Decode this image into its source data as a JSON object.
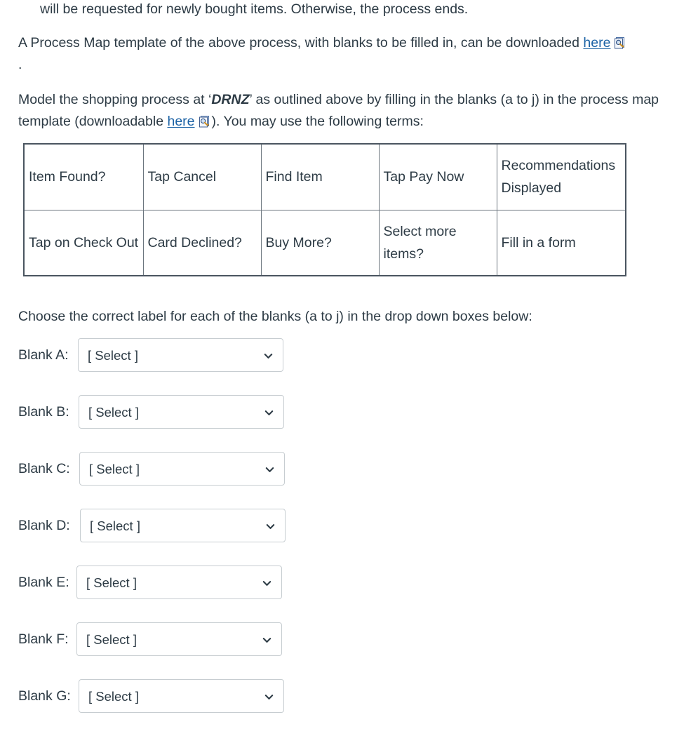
{
  "paragraphs": {
    "p1": "will be requested for newly bought items. Otherwise, the process ends.",
    "p2_before": "A Process Map template of the above process, with blanks to be filled in, can be downloaded ",
    "p2_link": "here",
    "p2_dot": ".",
    "p3_a": "Model the shopping process at ‘",
    "p3_emph": "DRNZ",
    "p3_b": "’ as outlined above by filling in the blanks (a to j) in the process map template (downloadable ",
    "p3_link": "here",
    "p3_c": "). You may use the following terms:",
    "p4": "Choose the correct label for each of the blanks (a to j) in the drop down boxes below:"
  },
  "terms_table": {
    "rows": [
      [
        "Item Found?",
        "Tap Cancel",
        "Find Item",
        "Tap Pay Now",
        "Recommendations Displayed"
      ],
      [
        "Tap on Check Out",
        "Card Declined?",
        "Buy More?",
        "Select more items?",
        "Fill in a form"
      ]
    ]
  },
  "blanks": [
    {
      "label": "Blank A:",
      "value": "[ Select ]",
      "left_label": 26,
      "left_select": 111
    },
    {
      "label": "Blank B:",
      "value": "[ Select ]",
      "left_label": 26,
      "left_select": 112
    },
    {
      "label": "Blank C:",
      "value": "[ Select ]",
      "left_label": 26,
      "left_select": 113
    },
    {
      "label": "Blank D:",
      "value": "[ Select ]",
      "left_label": 26,
      "left_select": 114
    },
    {
      "label": "Blank E:",
      "value": "[ Select ]",
      "left_label": 26,
      "left_select": 109
    },
    {
      "label": "Blank F:",
      "value": "[ Select ]",
      "left_label": 26,
      "left_select": 109
    },
    {
      "label": "Blank G:",
      "value": "[ Select ]",
      "left_label": 26,
      "left_select": 112
    }
  ],
  "icons": {
    "document_preview": "document-preview-icon",
    "chevron_down": "chevron-down-icon"
  },
  "colors": {
    "text": "#2D3B45",
    "link": "#1B62A5",
    "select_border": "#C7CDD1",
    "table_outer_border": "#4a5560",
    "table_inner_border": "#6b757e",
    "background": "#ffffff"
  }
}
